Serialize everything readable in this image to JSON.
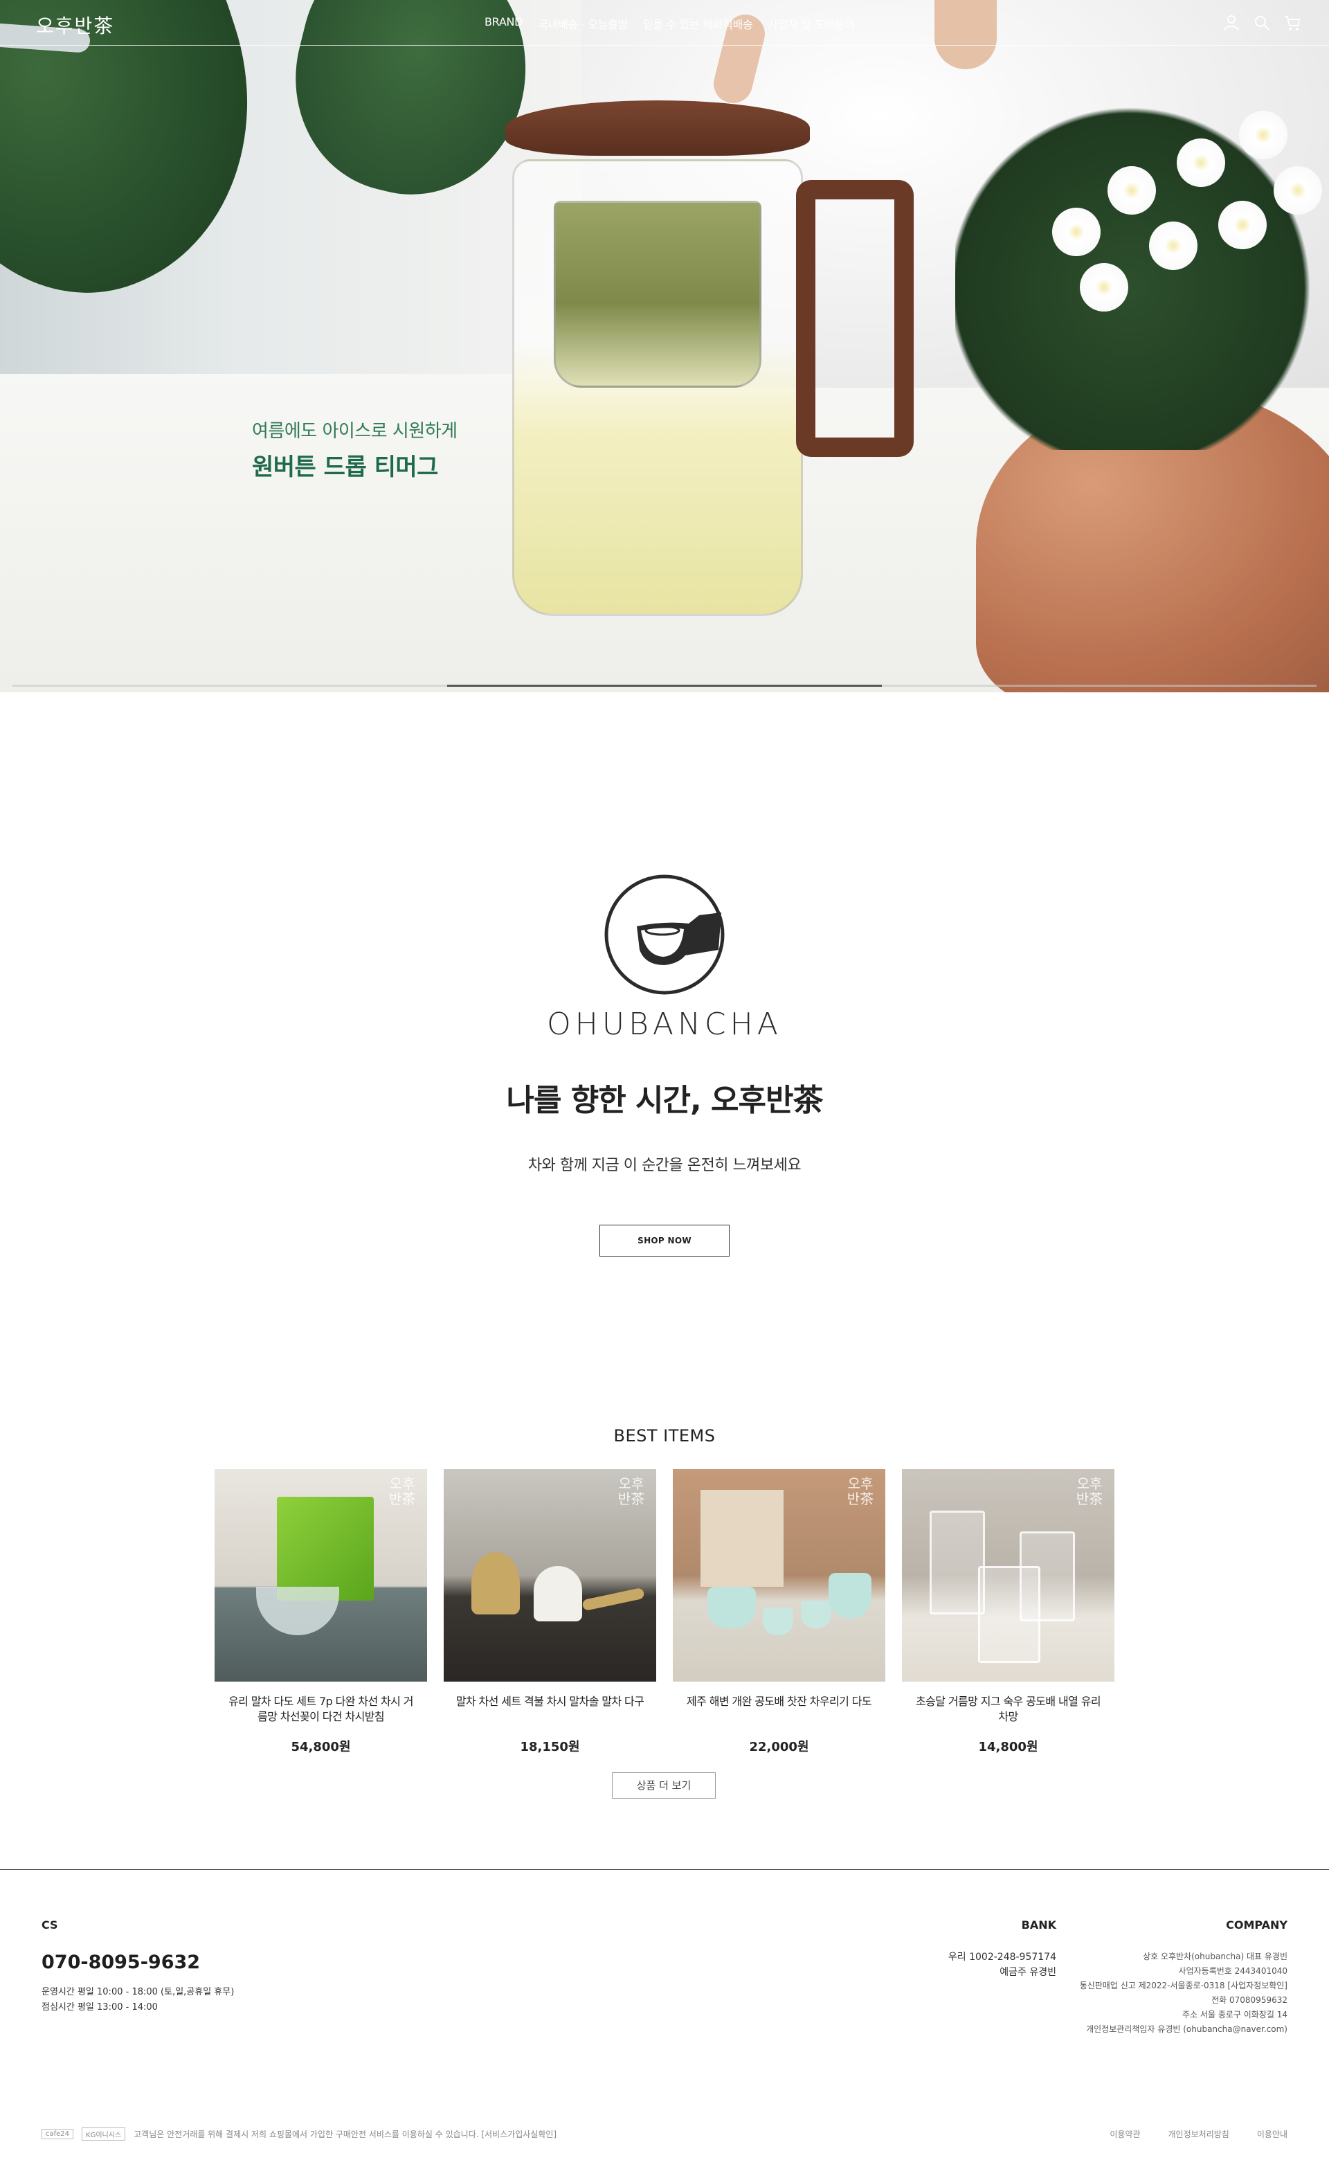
{
  "header": {
    "logo": "오후반茶",
    "nav": [
      "BRAND",
      "국내배송 · 오늘출발",
      "믿을 수 있는 해외직배송",
      "사업자 및 도매문의"
    ],
    "icons": [
      "user-icon",
      "search-icon",
      "cart-icon"
    ]
  },
  "hero": {
    "subtitle": "여름에도 아이스로 시원하게",
    "title": "원버튼 드롭 티머그",
    "slide_progress": {
      "current": 2,
      "total": 3
    }
  },
  "brand": {
    "wordmark": "OHUBANCHA",
    "title": "나를 향한 시간, 오후반茶",
    "subtitle": "차와 함께 지금 이 순간을 온전히 느껴보세요",
    "shop_now": "SHOP NOW"
  },
  "best": {
    "title": "BEST ITEMS",
    "watermark": "오후\n반茶",
    "items": [
      {
        "name": "유리 말차 다도 세트 7p 다완 차선 차시 거름망 차선꽂이 다건 차시받침",
        "price": "54,800원"
      },
      {
        "name": "말차 차선 세트 격불 차시 말차솔 말차 다구",
        "price": "18,150원"
      },
      {
        "name": "제주 해변 개완 공도배 찻잔 차우리기 다도",
        "price": "22,000원"
      },
      {
        "name": "초승달 거름망 지그 숙우 공도배 내열 유리 차망",
        "price": "14,800원"
      }
    ],
    "more": "상품 더 보기"
  },
  "footer": {
    "cs": {
      "title": "CS",
      "phone": "070-8095-9632",
      "hours": "운영시간 평일 10:00 - 18:00 (토,일,공휴일 휴무)",
      "lunch": "점심시간 평일 13:00 - 14:00"
    },
    "bank": {
      "title": "BANK",
      "account": "우리  1002-248-957174",
      "holder": "예금주  유경빈"
    },
    "company": {
      "title": "COMPANY",
      "lines": [
        "상호  오후반차(ohubancha)   대표  유경빈",
        "사업자등록번호  2443401040",
        "통신판매업 신고  제2022-서울종로-0318  [사업자정보확인]",
        "전화  07080959632",
        "주소  서울 종로구 이화장길 14",
        "개인정보관리책임자  유경빈 (ohubancha@naver.com)"
      ]
    },
    "badges": [
      "cafe24",
      "KG이니시스"
    ],
    "escrow": "고객님은 안전거래를 위해 결제시 저희 쇼핑몰에서 가입한 구매안전 서비스를 이용하실 수 있습니다.  [서비스가입사실확인]",
    "links": [
      "이용약관",
      "개인정보처리방침",
      "이용안내"
    ]
  }
}
